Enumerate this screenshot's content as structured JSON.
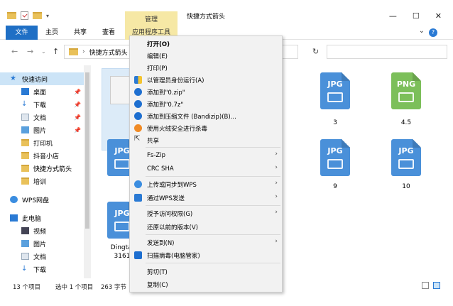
{
  "window": {
    "title": "快捷方式箭头",
    "context_tab_top": "管理",
    "minimize": "—",
    "maximize": "☐",
    "close": "✕"
  },
  "ribbon": {
    "tabs": [
      "文件",
      "主页",
      "共享",
      "查看",
      "应用程序工具"
    ]
  },
  "address": {
    "path": "快捷方式箭头"
  },
  "sidebar": {
    "items": [
      {
        "label": "快速访问"
      },
      {
        "label": "桌面"
      },
      {
        "label": "下载"
      },
      {
        "label": "文档"
      },
      {
        "label": "图片"
      },
      {
        "label": "打印机"
      },
      {
        "label": "抖音小店"
      },
      {
        "label": "快捷方式箭头"
      },
      {
        "label": "培训"
      },
      {
        "label": "WPS网盘"
      },
      {
        "label": "此电脑"
      },
      {
        "label": "视频"
      },
      {
        "label": "图片"
      },
      {
        "label": "文档"
      },
      {
        "label": "下载"
      }
    ]
  },
  "files": [
    {
      "type": "JPG",
      "label": "3"
    },
    {
      "type": "PNG",
      "label": "4.5"
    },
    {
      "type": "JPG",
      "label": "9"
    },
    {
      "type": "JPG",
      "label": "10"
    },
    {
      "type": "JPG",
      "label": ""
    },
    {
      "type": "JPG",
      "label": "Dingtal"
    },
    {
      "type": "",
      "label": "3161"
    }
  ],
  "status": {
    "count": "13 个项目",
    "selected": "选中 1 个项目",
    "size": "263 字节"
  },
  "context_menu": {
    "items": [
      "打开(O)",
      "编辑(E)",
      "打印(P)",
      "以管理员身份运行(A)",
      "添加到\"0.zip\"",
      "添加到\"0.7z\"",
      "添加到压缩文件 (Bandizip)(B)...",
      "使用火绒安全进行杀毒",
      "共享",
      "Fs-Zip",
      "CRC SHA",
      "上传或同步到WPS",
      "通过WPS发送",
      "授予访问权限(G)",
      "还原以前的版本(V)",
      "发送到(N)",
      "扫描病毒(电脑管家)",
      "剪切(T)",
      "复制(C)"
    ]
  },
  "colors": {
    "accent": "#1f6fc5",
    "context_tab": "#f6e8a5",
    "jpg": "#4a90d9",
    "png": "#7cbf5a"
  }
}
